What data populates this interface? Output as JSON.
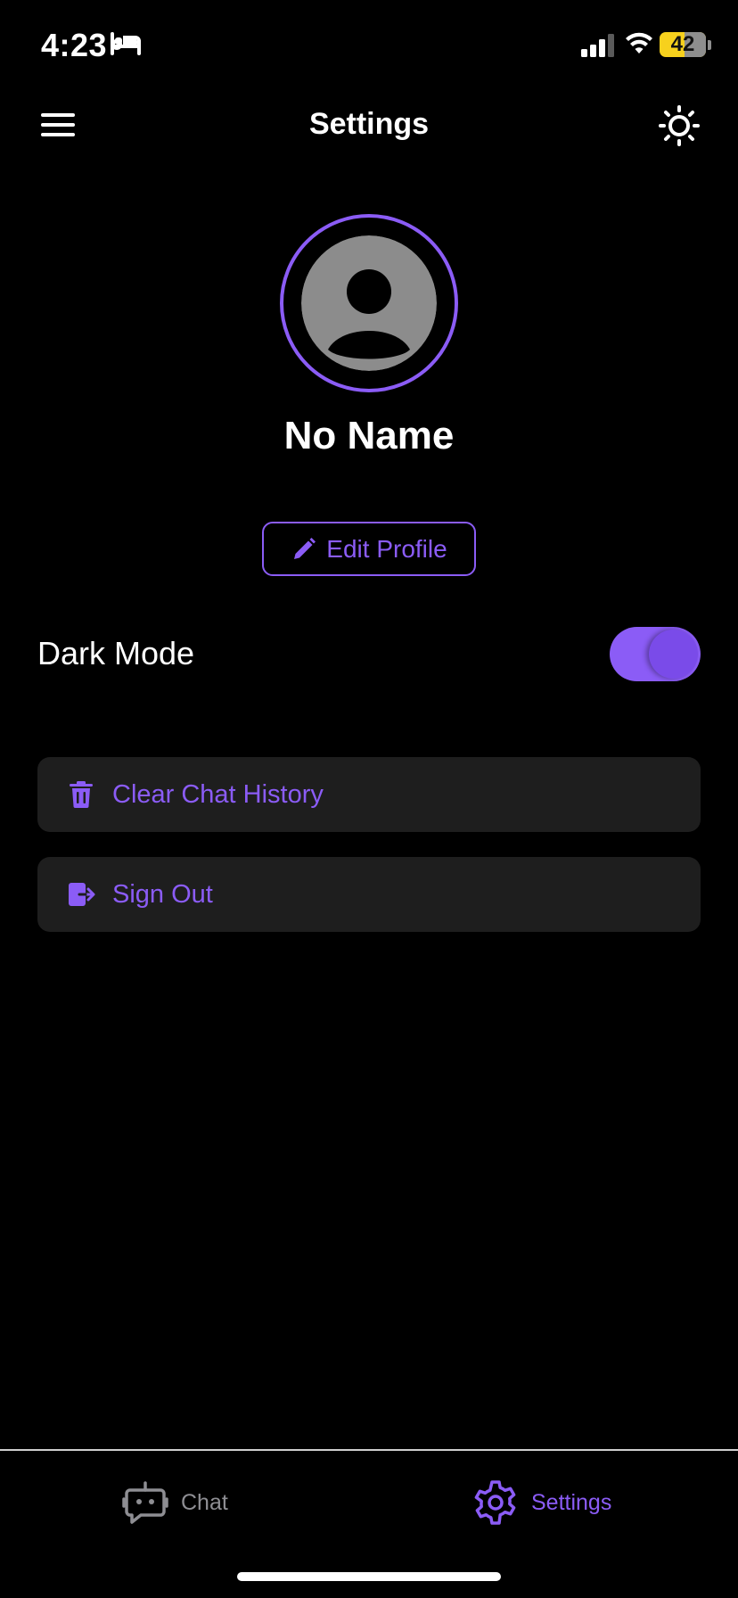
{
  "status_bar": {
    "time": "4:23",
    "battery": "42",
    "icons": [
      "sleep-icon",
      "signal-icon",
      "wifi-icon",
      "battery-icon"
    ]
  },
  "header": {
    "title": "Settings",
    "left_icon": "menu-icon",
    "right_icon": "sun-icon"
  },
  "profile": {
    "name": "No Name",
    "avatar_icon": "person-icon",
    "edit_label": "Edit Profile",
    "edit_icon": "pencil-icon"
  },
  "dark_mode": {
    "label": "Dark Mode",
    "enabled": true
  },
  "actions": [
    {
      "label": "Clear Chat History",
      "icon": "trash-icon"
    },
    {
      "label": "Sign Out",
      "icon": "sign-out-icon"
    }
  ],
  "tabs": [
    {
      "label": "Chat",
      "icon": "robot-icon",
      "active": false
    },
    {
      "label": "Settings",
      "icon": "gear-icon",
      "active": true
    }
  ],
  "colors": {
    "accent": "#8b5cf6",
    "background": "#000000",
    "card": "#1e1e1e",
    "inactive": "#8e8e93"
  }
}
